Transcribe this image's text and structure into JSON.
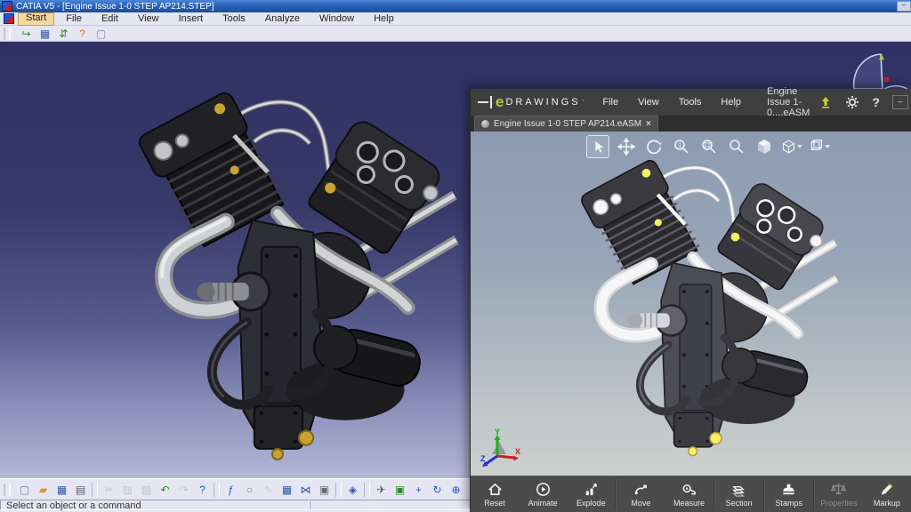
{
  "catia": {
    "window_title": "CATIA V5 - [Engine Issue 1-0 STEP AP214.STEP]",
    "window_buttons": {
      "minimize": "–"
    },
    "menus": [
      {
        "label": "Start",
        "active": true
      },
      {
        "label": "File"
      },
      {
        "label": "Edit"
      },
      {
        "label": "View"
      },
      {
        "label": "Insert"
      },
      {
        "label": "Tools"
      },
      {
        "label": "Analyze"
      },
      {
        "label": "Window"
      },
      {
        "label": "Help"
      }
    ],
    "top_toolbar": [
      {
        "name": "exit-workbench-icon",
        "glyph": "↪",
        "color": "#2e8b2e"
      },
      {
        "name": "save-icon",
        "glyph": "▦",
        "color": "#2f54a8"
      },
      {
        "name": "save-management-icon",
        "glyph": "⇵",
        "color": "#2e8b2e"
      },
      {
        "name": "help-icon",
        "glyph": "?",
        "color": "#c77f00"
      },
      {
        "name": "new-window-icon",
        "glyph": "▢",
        "color": "#8888a0"
      }
    ],
    "bottom_toolbar": [
      {
        "name": "new-document-icon",
        "glyph": "▢",
        "color": "#77778c"
      },
      {
        "name": "open-icon",
        "glyph": "▰",
        "color": "#d79b2a"
      },
      {
        "name": "save-icon",
        "glyph": "▦",
        "color": "#2f54a8"
      },
      {
        "name": "print-icon",
        "glyph": "▤",
        "color": "#5a5a66"
      },
      {
        "name": "divider",
        "sep": true
      },
      {
        "name": "cut-icon",
        "glyph": "✂",
        "color": "#9a9aa6",
        "disabled": true
      },
      {
        "name": "copy-icon",
        "glyph": "▥",
        "color": "#9a9aa6",
        "disabled": true
      },
      {
        "name": "paste-icon",
        "glyph": "▧",
        "color": "#9a9aa6",
        "disabled": true
      },
      {
        "name": "undo-icon",
        "glyph": "↶",
        "color": "#2e8b2e"
      },
      {
        "name": "redo-icon",
        "glyph": "↷",
        "color": "#9a9aa6",
        "disabled": true
      },
      {
        "name": "whats-this-icon",
        "glyph": "?",
        "color": "#2255cc"
      },
      {
        "name": "divider",
        "sep": true
      },
      {
        "name": "formula-icon",
        "glyph": "ƒ",
        "color": "#2255cc"
      },
      {
        "name": "comment-icon",
        "glyph": "○",
        "color": "#7a7a88"
      },
      {
        "name": "knowledge-icon",
        "glyph": "✎",
        "color": "#a8a8b4",
        "disabled": true
      },
      {
        "name": "design-table-icon",
        "glyph": "▦",
        "color": "#2f54a8"
      },
      {
        "name": "relations-icon",
        "glyph": "⋈",
        "color": "#2f54a8"
      },
      {
        "name": "lock-icon",
        "glyph": "▣",
        "color": "#6a6a76"
      },
      {
        "name": "divider",
        "sep": true
      },
      {
        "name": "product-structure-icon",
        "glyph": "◈",
        "color": "#2f54a8"
      },
      {
        "name": "divider",
        "sep": true
      },
      {
        "name": "fly-mode-icon",
        "glyph": "✈",
        "color": "#5a5a66"
      },
      {
        "name": "fit-all-in-icon",
        "glyph": "▣",
        "color": "#2e8b2e"
      },
      {
        "name": "pan-icon",
        "glyph": "+",
        "color": "#2255cc"
      },
      {
        "name": "rotate-icon",
        "glyph": "↻",
        "color": "#2255cc"
      },
      {
        "name": "zoom-in-icon",
        "glyph": "⊕",
        "color": "#2255cc"
      },
      {
        "name": "zoom-out-icon",
        "glyph": "⊖",
        "color": "#2255cc"
      },
      {
        "name": "normal-view-icon",
        "glyph": "↥",
        "color": "#2255cc"
      },
      {
        "name": "multi-view-icon",
        "glyph": "▦",
        "color": "#2f54a8"
      },
      {
        "name": "isometric-view-icon",
        "glyph": "◧",
        "color": "#2f54a8",
        "caret": "▾"
      },
      {
        "name": "shading-mode-icon",
        "glyph": "◨",
        "color": "#d97b1e",
        "caret": "▾"
      },
      {
        "name": "hide-show-icon",
        "glyph": "⇄",
        "color": "#2f54a8"
      },
      {
        "name": "visible-space-icon",
        "glyph": "⇆",
        "color": "#2f54a8"
      },
      {
        "name": "divider",
        "sep": true
      },
      {
        "name": "render-camera-icon",
        "glyph": "▬",
        "color": "#44444c"
      }
    ],
    "status_left": "Select an object or a command",
    "status_right": ""
  },
  "edrawings": {
    "logo_e": "e",
    "logo_text": "DRAWINGS",
    "logo_mark": "’",
    "menus": [
      "File",
      "View",
      "Tools",
      "Help"
    ],
    "doc_title": "Engine Issue 1-0....eASM",
    "titlebar_help_glyph": "?",
    "window_buttons": {
      "minimize": "–"
    },
    "tab": {
      "label": "Engine Issue 1-0 STEP AP214.eASM",
      "close": "×"
    },
    "view_toolbar_icons": [
      "select-tool",
      "pan-tool",
      "rotate-tool",
      "zoom-fit-tool",
      "zoom-area-tool",
      "zoom-tool",
      "shaded-tool",
      "display-mode-dropdown",
      "orientation-dropdown"
    ],
    "bottom_buttons": [
      {
        "label": "Reset"
      },
      {
        "label": "Animate"
      },
      {
        "label": "Explode"
      },
      {
        "label": "Move"
      },
      {
        "label": "Measure"
      },
      {
        "label": "Section"
      },
      {
        "label": "Stamps"
      },
      {
        "label": "Properties",
        "disabled": true
      },
      {
        "label": "Markup"
      }
    ],
    "triad_labels": {
      "x": "X",
      "y": "Y",
      "z": "Z"
    }
  },
  "model": {
    "description": "Black V-twin piston engine assembly with finned cylinders, silver exhaust pipes and brass fittings"
  },
  "colors": {
    "catia_titlebar": "#2a62b8",
    "catia_panel": "#e6e6f2",
    "catia_viewport_top": "#303265",
    "catia_viewport_bottom": "#b3b7d8",
    "edrawings_chrome": "#3f3f3f",
    "edrawings_green": "#b0c837",
    "edrawings_viewport_top": "#8d9bb1",
    "edrawings_viewport_bottom": "#ccd1ce"
  }
}
